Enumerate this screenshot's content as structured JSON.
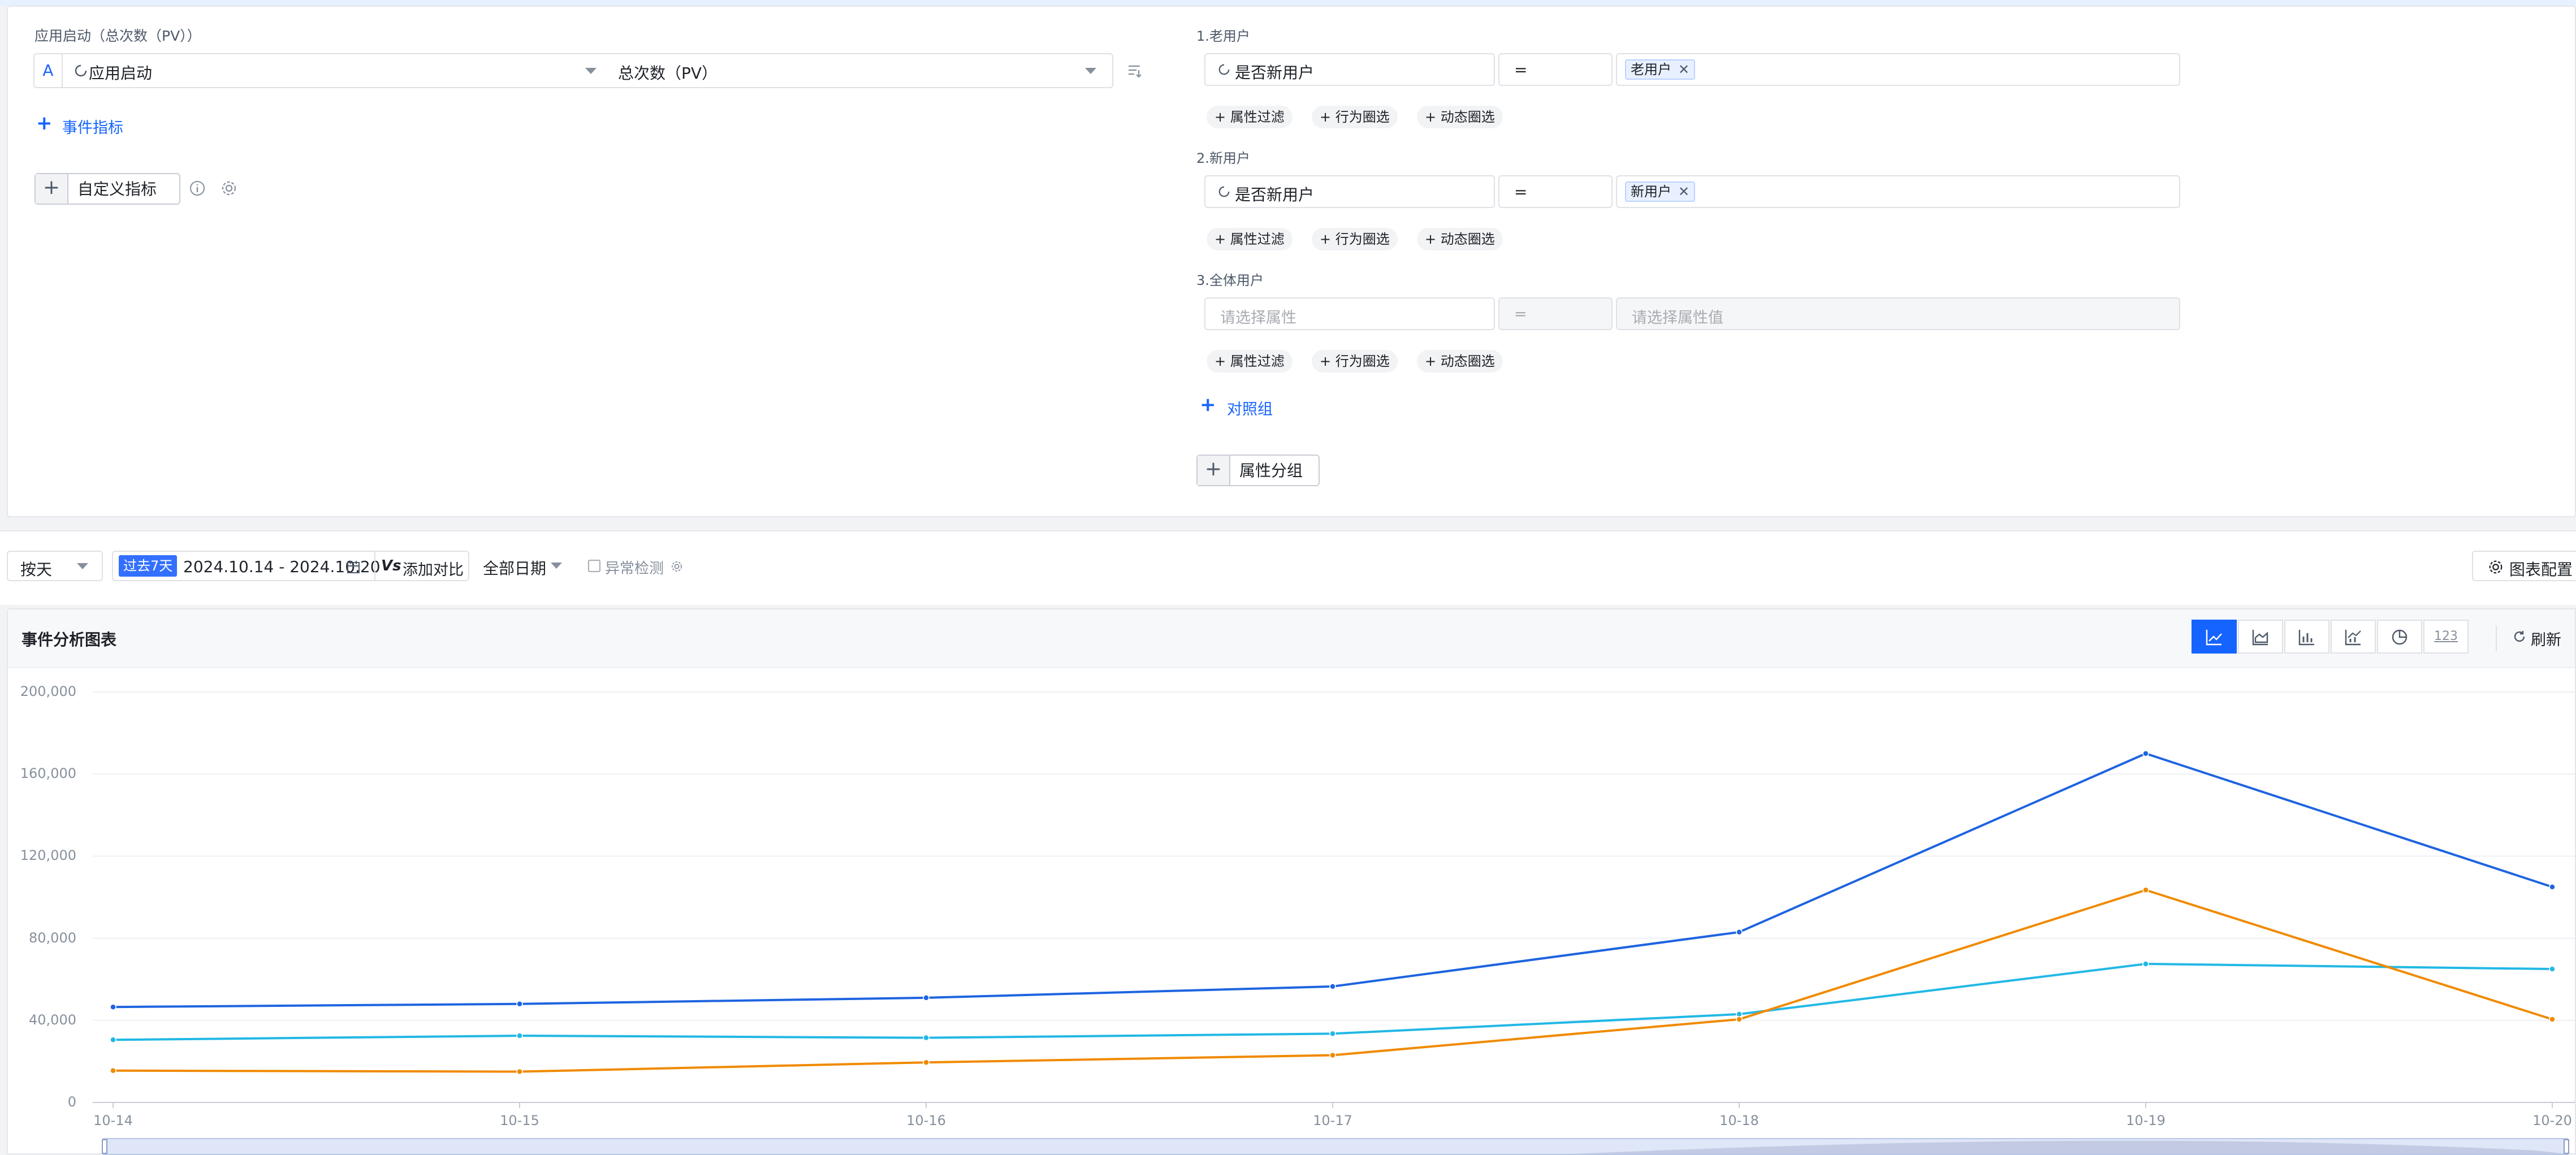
{
  "metric": {
    "section_label": "应用启动（总次数（PV））",
    "letter": "A",
    "event_name": "应用启动",
    "measure": "总次数（PV）",
    "add_event_label": "事件指标",
    "custom_metric_label": "自定义指标"
  },
  "groups": [
    {
      "title": "1.老用户",
      "property": "是否新用户",
      "operator": "=",
      "value_tag": "老用户",
      "value_placeholder": ""
    },
    {
      "title": "2.新用户",
      "property": "是否新用户",
      "operator": "=",
      "value_tag": "新用户",
      "value_placeholder": ""
    },
    {
      "title": "3.全体用户",
      "property_placeholder": "请选择属性",
      "operator": "=",
      "value_placeholder": "请选择属性值"
    }
  ],
  "filter_chips": [
    "属性过滤",
    "行为圈选",
    "动态圈选"
  ],
  "add_group_label": "对照组",
  "property_group_label": "属性分组",
  "toolbar": {
    "granularity": "按天",
    "date_badge": "过去7天",
    "date_range": "2024.10.14 - 2024.10.20",
    "compare_label": "添加对比",
    "compare_prefix": "Vs",
    "day_filter": "全部日期",
    "anomaly_label": "异常检测",
    "chart_config_label": "图表配置"
  },
  "card": {
    "title": "事件分析图表",
    "refresh_label": "刷新",
    "chart_types": [
      {
        "icon": "line-chart-icon",
        "active": true
      },
      {
        "icon": "area-chart-icon",
        "active": false
      },
      {
        "icon": "bar-chart-icon",
        "active": false
      },
      {
        "icon": "combo-chart-icon",
        "active": false
      },
      {
        "icon": "pie-chart-icon",
        "active": false
      },
      {
        "icon": "number-icon",
        "text": "123",
        "active": false
      }
    ]
  },
  "chart_data": {
    "type": "line",
    "categories": [
      "10-14",
      "10-15",
      "10-16",
      "10-17",
      "10-18",
      "10-19",
      "10-20"
    ],
    "ylim": [
      0,
      200000
    ],
    "yticks": [
      "200,000",
      "160,000",
      "120,000",
      "80,000",
      "40,000",
      "0"
    ],
    "ytick_values": [
      200000,
      160000,
      120000,
      80000,
      40000,
      0
    ],
    "series": [
      {
        "color": "#1e64e0",
        "values": [
          46500,
          48000,
          51000,
          56500,
          83000,
          170000,
          105000
        ]
      },
      {
        "color": "#22b8e6",
        "values": [
          30500,
          32500,
          31500,
          33500,
          43000,
          67500,
          65000
        ]
      },
      {
        "color": "#f08a00",
        "values": [
          15500,
          15000,
          19500,
          23000,
          40500,
          103500,
          40500
        ]
      }
    ],
    "grid": true
  }
}
